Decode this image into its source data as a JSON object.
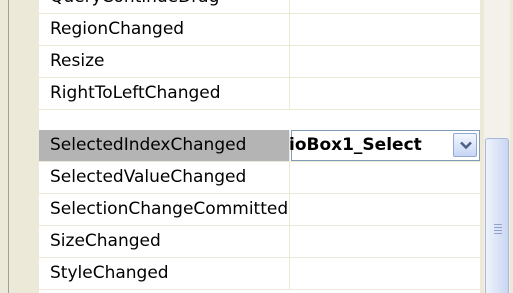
{
  "events": [
    {
      "name": "QueryContinueDrag",
      "value": ""
    },
    {
      "name": "RegionChanged",
      "value": ""
    },
    {
      "name": "Resize",
      "value": ""
    },
    {
      "name": "RightToLeftChanged",
      "value": ""
    },
    {
      "name": "SelectedIndexChanged",
      "value": "ioBox1_Select",
      "selected": true
    },
    {
      "name": "SelectedValueChanged",
      "value": ""
    },
    {
      "name": "SelectionChangeCommitted",
      "value": ""
    },
    {
      "name": "SizeChanged",
      "value": ""
    },
    {
      "name": "StyleChanged",
      "value": ""
    }
  ],
  "editor": {
    "value": "ioBox1_Select",
    "dropdown_icon": "chevron-down-icon"
  },
  "colors": {
    "selected_row": "#b4b4b4",
    "grid_line": "#ece9d8",
    "dropdown_accent": "#c6d5f6"
  }
}
